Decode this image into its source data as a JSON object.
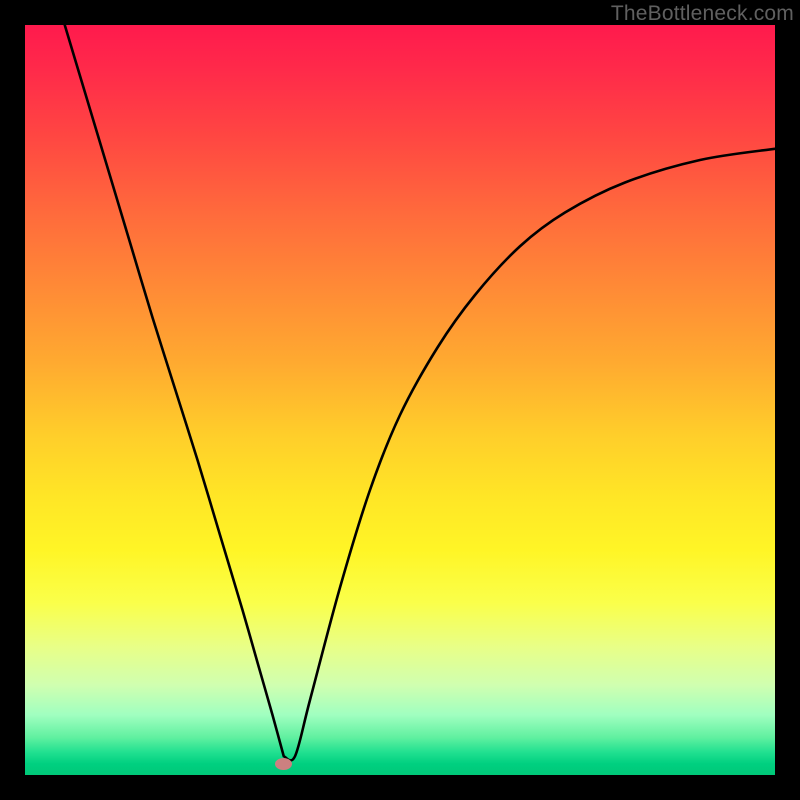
{
  "watermark": "TheBottleneck.com",
  "chart_data": {
    "type": "line",
    "title": "",
    "xlabel": "",
    "ylabel": "",
    "xlim": [
      0,
      100
    ],
    "ylim": [
      0,
      100
    ],
    "grid": false,
    "legend": false,
    "series": [
      {
        "name": "bottleneck-curve",
        "x": [
          5.3,
          8.0,
          11.0,
          14.0,
          17.0,
          20.0,
          23.0,
          26.0,
          29.0,
          31.0,
          33.0,
          34.5,
          36.0,
          38.0,
          42.0,
          46.0,
          50.0,
          55.0,
          60.0,
          66.0,
          72.0,
          80.0,
          90.0,
          100.0
        ],
        "values": [
          100.0,
          91.0,
          81.0,
          71.0,
          61.0,
          51.5,
          42.0,
          32.0,
          22.0,
          15.0,
          8.0,
          2.5,
          2.5,
          10.0,
          25.0,
          38.0,
          48.0,
          57.0,
          64.0,
          70.5,
          75.0,
          79.0,
          82.0,
          83.5
        ]
      }
    ],
    "marker": {
      "x": 34.5,
      "y": 1.5
    },
    "background_gradient": {
      "top": "#ff1a4d",
      "mid": "#ffe626",
      "bottom": "#00c878"
    }
  }
}
